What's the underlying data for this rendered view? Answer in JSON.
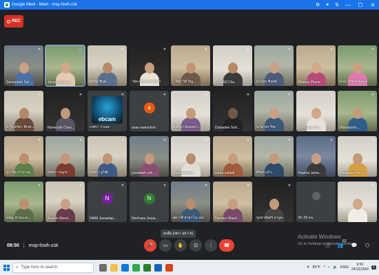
{
  "window": {
    "tab_title": "Google Meet - Meet - msp-fzwh-zsk",
    "icons": [
      "⚙",
      "✦",
      "⇅"
    ],
    "minimize": "—",
    "maximize": "☐",
    "close": "✕"
  },
  "recording": {
    "label": "REC",
    "color": "#d93025"
  },
  "participants": [
    {
      "name": "Sameehah Sal...",
      "mic": "muted",
      "kind": "video",
      "scene": "scene-a",
      "skin": "#c9a086",
      "cloth": "#4a6fa5"
    },
    {
      "name": "Janya Singhat...",
      "mic": "active",
      "kind": "video",
      "scene": "scene-g",
      "skin": "#d2a888",
      "cloth": "#e6c9b2",
      "speaking": true
    },
    {
      "name": "ทัศนีย์ ชินพ...",
      "mic": "muted",
      "kind": "video",
      "scene": "scene-b",
      "skin": "#b88b6c",
      "cloth": "#5b6e8c"
    },
    {
      "name": "วนิดา ยิ่งสมพงษ์เลา",
      "mic": "muted",
      "kind": "video",
      "scene": "scene-h",
      "skin": "#c89b7a",
      "cloth": "#e9e1d4"
    },
    {
      "name": "...ริตา วิดี ปัญ...",
      "mic": "muted",
      "kind": "video",
      "scene": "scene-f",
      "skin": "#c29574",
      "cloth": "#6d5a4a"
    },
    {
      "name": "MANAS Chu",
      "mic": "muted",
      "kind": "video",
      "scene": "scene-d",
      "skin": "#b88966",
      "cloth": "#3a3a3a"
    },
    {
      "name": "มานพร พินทธ์",
      "mic": "muted",
      "kind": "video",
      "scene": "scene-c",
      "skin": "#c9a086",
      "cloth": "#4c5c7a"
    },
    {
      "name": "Matima Pilana",
      "mic": "muted",
      "kind": "video",
      "scene": "scene-f",
      "skin": "#d2a888",
      "cloth": "#b84a7a"
    },
    {
      "name": "นาฝ อภิชาต ผู้ดูแล",
      "mic": "muted",
      "kind": "video",
      "scene": "scene-g",
      "skin": "#caa083",
      "cloth": "#e07bb0"
    },
    {
      "name": "มารินทร์ดา ตีเรต...",
      "mic": "muted",
      "kind": "video",
      "scene": "scene-b",
      "skin": "#b4876a",
      "cloth": "#6b4a3a"
    },
    {
      "name": "Nareeyah Chen...",
      "mic": "muted",
      "kind": "video",
      "scene": "scene-h",
      "skin": "#c39a7c",
      "cloth": "#556"
    },
    {
      "name": "เกศรา ว่าแดะ",
      "mic": "muted",
      "kind": "webcam",
      "logo_text": "ebcam"
    },
    {
      "name": "anas waesohoh",
      "mic": "muted",
      "kind": "avatar",
      "initial": "a",
      "avatar_color": "#e8590c"
    },
    {
      "name": "ดีสตินา อับดุลลา...",
      "mic": "muted",
      "kind": "video",
      "scene": "scene-d",
      "skin": "#c59b7a",
      "cloth": "#7a5c8c"
    },
    {
      "name": "Dutsadee Srid...",
      "mic": "muted",
      "kind": "video",
      "scene": "scene-h",
      "skin": "#6f5a4a",
      "cloth": "#222"
    },
    {
      "name": "นานาพร รีซะ",
      "mic": "muted",
      "kind": "video",
      "scene": "scene-c",
      "skin": "#c9a086",
      "cloth": "#3b5a7a"
    },
    {
      "name": "Safuucos Mh...",
      "mic": "muted",
      "kind": "video",
      "scene": "scene-d",
      "skin": "#d0a787",
      "cloth": "#e7e2da"
    },
    {
      "name": "Waranporn ...",
      "mic": "muted",
      "kind": "video",
      "scene": "scene-g",
      "skin": "#c6997a",
      "cloth": "#2f5d8a"
    },
    {
      "name": "นูรานีดาร์ ดาวดู...",
      "mic": "muted",
      "kind": "video",
      "scene": "scene-f",
      "skin": "#bb8e6e",
      "cloth": "#5e7f4a"
    },
    {
      "name": "นริศรา หนูก่อ",
      "mic": "muted",
      "kind": "video",
      "scene": "scene-c",
      "skin": "#c6977a",
      "cloth": "#7e3a2f"
    },
    {
      "name": "นริศรา ยูโซ๊ะ",
      "mic": "muted",
      "kind": "video",
      "scene": "scene-b",
      "skin": "#c09475",
      "cloth": "#3e5a86"
    },
    {
      "name": "yuswidah soh...",
      "mic": "muted",
      "kind": "video",
      "scene": "scene-a",
      "skin": "#c59a7c",
      "cloth": "#8a4f72"
    },
    {
      "name": "Abdulrahima...",
      "mic": "muted",
      "kind": "video",
      "scene": "scene-d",
      "skin": "#b98c6b",
      "cloth": "#e2ddd4"
    },
    {
      "name": "suma sahadi",
      "mic": "muted",
      "kind": "video",
      "scene": "scene-f",
      "skin": "#c89d7e",
      "cloth": "#a05b3a"
    },
    {
      "name": "ศิริพร แก้ว...",
      "mic": "muted",
      "kind": "video",
      "scene": "scene-c",
      "skin": "#c39a7c",
      "cloth": "#2e4a6a"
    },
    {
      "name": "Nuphat Janta...",
      "mic": "muted",
      "kind": "video",
      "scene": "scene-e",
      "skin": "#c9a086",
      "cloth": "#3a3a3a"
    },
    {
      "name": "Hassanee Hes...",
      "mic": "muted",
      "kind": "video",
      "scene": "scene-d",
      "skin": "#c4987a",
      "cloth": "#d6a040"
    },
    {
      "name": "นพฎ. ตาเมะเล...",
      "mic": "muted",
      "kind": "video",
      "scene": "scene-g",
      "skin": "#bd906f",
      "cloth": "#5a6e4a"
    },
    {
      "name": "Tasnim Mand...",
      "mic": "muted",
      "kind": "video",
      "scene": "scene-b",
      "skin": "#c9a086",
      "cloth": "#6a3a4a"
    },
    {
      "name": "NIMA Jessadap...",
      "mic": "muted",
      "kind": "avatar",
      "initial": "N",
      "avatar_color": "#7b1fa2"
    },
    {
      "name": "Nirohaya Jessa...",
      "mic": "muted",
      "kind": "avatar",
      "initial": "N",
      "avatar_color": "#2e7d32"
    },
    {
      "name": "สุดาวดี สาตาโระ มณฑ",
      "mic": "muted",
      "kind": "video",
      "scene": "scene-a",
      "skin": "#b98c6b",
      "cloth": "#3b5a7a"
    },
    {
      "name": "Nisreen Waed...",
      "mic": "muted",
      "kind": "video",
      "scene": "scene-f",
      "skin": "#c89d7e",
      "cloth": "#7a4a6a"
    },
    {
      "name": "นูรฮาลัสตรี ลาบูด...",
      "mic": "muted",
      "kind": "video",
      "scene": "scene-h",
      "skin": "#c39a7c",
      "cloth": "#444"
    },
    {
      "name": "อีก 28 คน",
      "mic": "none",
      "kind": "more"
    },
    {
      "name": "",
      "mic": "muted",
      "kind": "video",
      "scene": "scene-d",
      "skin": "#d0a787",
      "cloth": "#f0ece6"
    }
  ],
  "meeting": {
    "time": "09:50",
    "separator": "|",
    "code": "msp-fzwh-zsk"
  },
  "tooltip": "ยกมือ (ctrl + alt + h)",
  "controls": {
    "mic": "🎤",
    "camera": "▭",
    "raise_hand": "✋",
    "present": "⊡",
    "more": "⋮",
    "hangup": "☎",
    "info": "ⓘ",
    "people": "👥",
    "chat": "💬",
    "activities": "⬡"
  },
  "people_count": "63",
  "activation": {
    "title": "Activate Windows",
    "subtitle": "Go to Settings to activate Windows."
  },
  "taskbar": {
    "search_placeholder": "Type here to search",
    "search_icon": "⌕",
    "temperature": "82°F",
    "language": "ENG",
    "clock_time": "9:50",
    "clock_date": "24/12/2564",
    "notifications_badge": "1"
  }
}
